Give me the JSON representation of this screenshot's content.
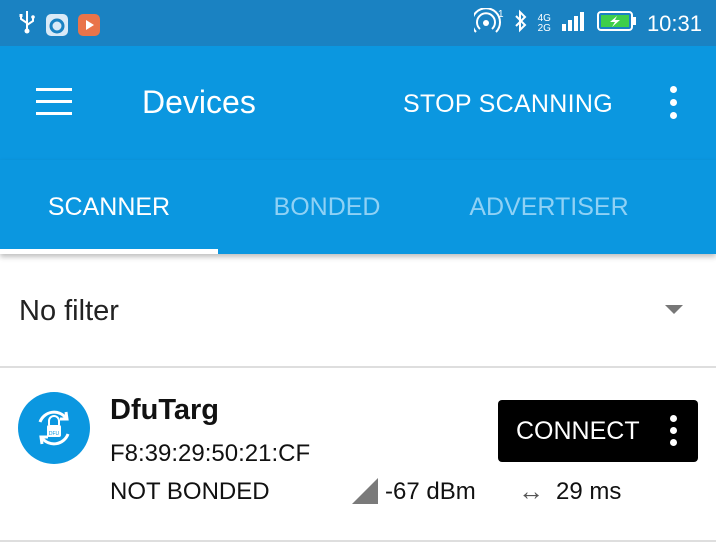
{
  "status_bar": {
    "time": "10:31",
    "network_label_1": "4G",
    "network_label_2": "2G",
    "wifi_hotspot_sup": "1",
    "left_icons": [
      "usb-icon",
      "cloud-app-icon",
      "video-app-icon"
    ],
    "right_icons": [
      "hotspot-icon",
      "bluetooth-icon",
      "signal-icon",
      "battery-charging-icon"
    ]
  },
  "toolbar": {
    "title": "Devices",
    "stop_scanning_label": "STOP SCANNING"
  },
  "tabs": [
    {
      "label": "SCANNER",
      "active": true
    },
    {
      "label": "BONDED",
      "active": false
    },
    {
      "label": "ADVERTISER",
      "active": false
    }
  ],
  "filter": {
    "selected": "No filter"
  },
  "devices": [
    {
      "name": "DfuTarg",
      "address": "F8:39:29:50:21:CF",
      "bond_state": "NOT BONDED",
      "rssi": "-67 dBm",
      "interval": "29 ms",
      "connect_label": "CONNECT",
      "icon": "dfu-icon"
    }
  ],
  "colors": {
    "status_bar": "#1a82c2",
    "primary": "#0b97e0",
    "tab_inactive": "#8fd1f5",
    "connect_button": "#000000"
  }
}
